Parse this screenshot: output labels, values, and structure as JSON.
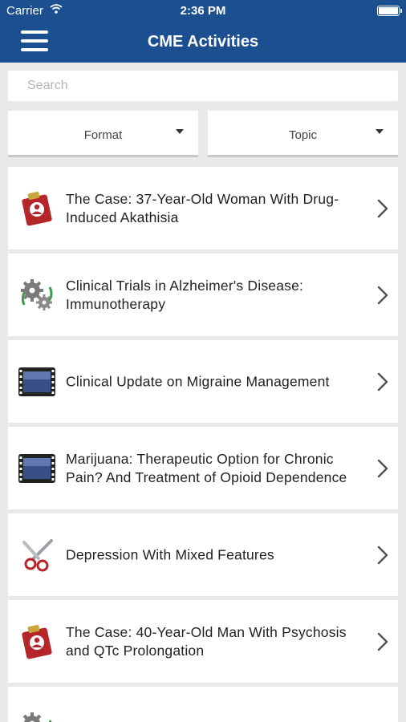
{
  "status_bar": {
    "carrier": "Carrier",
    "time": "2:36 PM"
  },
  "nav": {
    "title": "CME Activities",
    "menu_icon": "hamburger-menu-icon"
  },
  "search": {
    "placeholder": "Search",
    "value": ""
  },
  "filters": {
    "format": "Format",
    "topic": "Topic"
  },
  "activities": [
    {
      "title": "The Case: 37-Year-Old Woman With Drug-Induced Akathisia",
      "icon": "case-file-icon"
    },
    {
      "title": "Clinical Trials in Alzheimer's Disease: Immunotherapy",
      "icon": "gears-icon"
    },
    {
      "title": "Clinical Update on Migraine Management",
      "icon": "video-film-icon"
    },
    {
      "title": "Marijuana: Therapeutic Option for Chronic Pain? And Treatment of Opioid Dependence",
      "icon": "video-film-icon"
    },
    {
      "title": "Depression With Mixed Features",
      "icon": "scissors-icon"
    },
    {
      "title": "The Case: 40-Year-Old Man With Psychosis and QTc Prolongation",
      "icon": "case-file-icon"
    },
    {
      "title": "",
      "icon": "gears-icon"
    }
  ],
  "colors": {
    "nav_bg": "#1c4f8f",
    "page_bg": "#e9e9e9"
  }
}
